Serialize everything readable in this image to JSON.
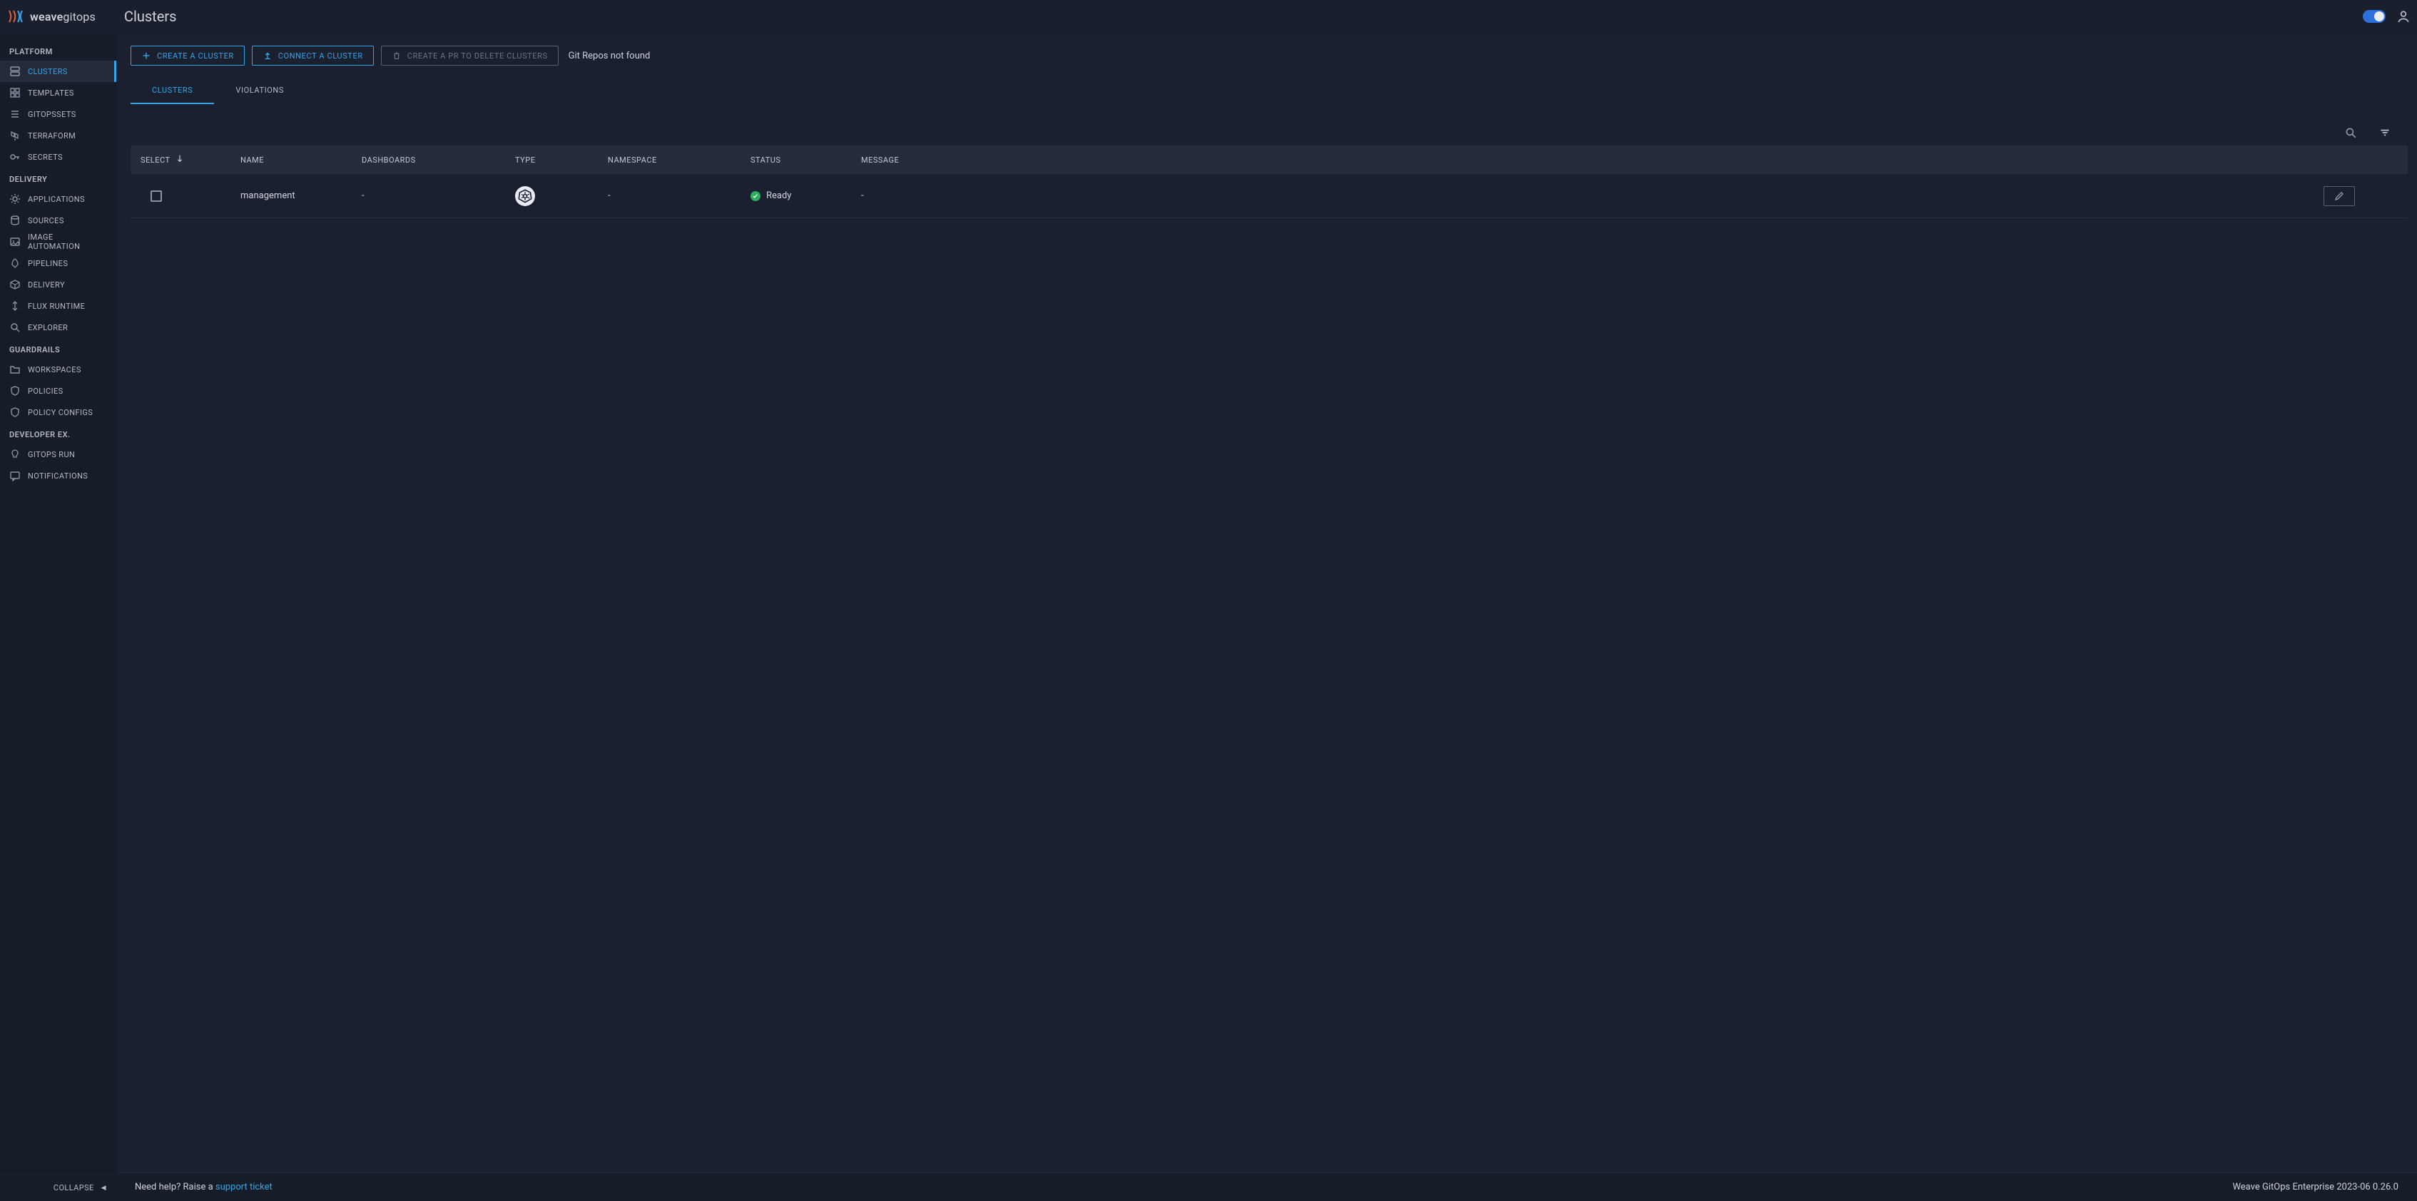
{
  "header": {
    "logo_prefix": "weave",
    "logo_suffix": "gitops",
    "page_title": "Clusters"
  },
  "sidebar": {
    "sections": [
      {
        "title": "PLATFORM",
        "items": [
          {
            "label": "CLUSTERS",
            "icon": "server-icon",
            "active": true
          },
          {
            "label": "TEMPLATES",
            "icon": "grid-icon",
            "active": false
          },
          {
            "label": "GITOPSSETS",
            "icon": "list-icon",
            "active": false
          },
          {
            "label": "TERRAFORM",
            "icon": "terraform-icon",
            "active": false
          },
          {
            "label": "SECRETS",
            "icon": "key-icon",
            "active": false
          }
        ]
      },
      {
        "title": "DELIVERY",
        "items": [
          {
            "label": "APPLICATIONS",
            "icon": "gear-icon"
          },
          {
            "label": "SOURCES",
            "icon": "database-icon"
          },
          {
            "label": "IMAGE AUTOMATION",
            "icon": "image-icon"
          },
          {
            "label": "PIPELINES",
            "icon": "rocket-icon"
          },
          {
            "label": "DELIVERY",
            "icon": "box-icon"
          },
          {
            "label": "FLUX RUNTIME",
            "icon": "flux-icon"
          },
          {
            "label": "EXPLORER",
            "icon": "search-icon"
          }
        ]
      },
      {
        "title": "GUARDRAILS",
        "items": [
          {
            "label": "WORKSPACES",
            "icon": "folder-icon"
          },
          {
            "label": "POLICIES",
            "icon": "shield-icon"
          },
          {
            "label": "POLICY CONFIGS",
            "icon": "shield-gear-icon"
          }
        ]
      },
      {
        "title": "DEVELOPER EX.",
        "items": [
          {
            "label": "GITOPS RUN",
            "icon": "bulb-icon"
          },
          {
            "label": "NOTIFICATIONS",
            "icon": "chat-icon"
          }
        ]
      }
    ],
    "collapse_label": "COLLAPSE"
  },
  "toolbar": {
    "create_cluster": "CREATE A CLUSTER",
    "connect_cluster": "CONNECT A CLUSTER",
    "delete_pr": "CREATE A PR TO DELETE CLUSTERS",
    "status_message": "Git Repos not found"
  },
  "tabs": {
    "clusters": "CLUSTERS",
    "violations": "VIOLATIONS"
  },
  "table": {
    "columns": {
      "select": "SELECT",
      "name": "NAME",
      "dashboards": "DASHBOARDS",
      "type": "TYPE",
      "namespace": "NAMESPACE",
      "status": "STATUS",
      "message": "MESSAGE"
    },
    "rows": [
      {
        "name": "management",
        "dashboards": "-",
        "type_icon": "kubernetes-icon",
        "namespace": "-",
        "status_label": "Ready",
        "status_ok": true,
        "message": "-"
      }
    ]
  },
  "footer": {
    "help_prefix": "Need help? Raise a ",
    "help_link": "support ticket",
    "version": "Weave GitOps Enterprise 2023-06 0.26.0"
  }
}
